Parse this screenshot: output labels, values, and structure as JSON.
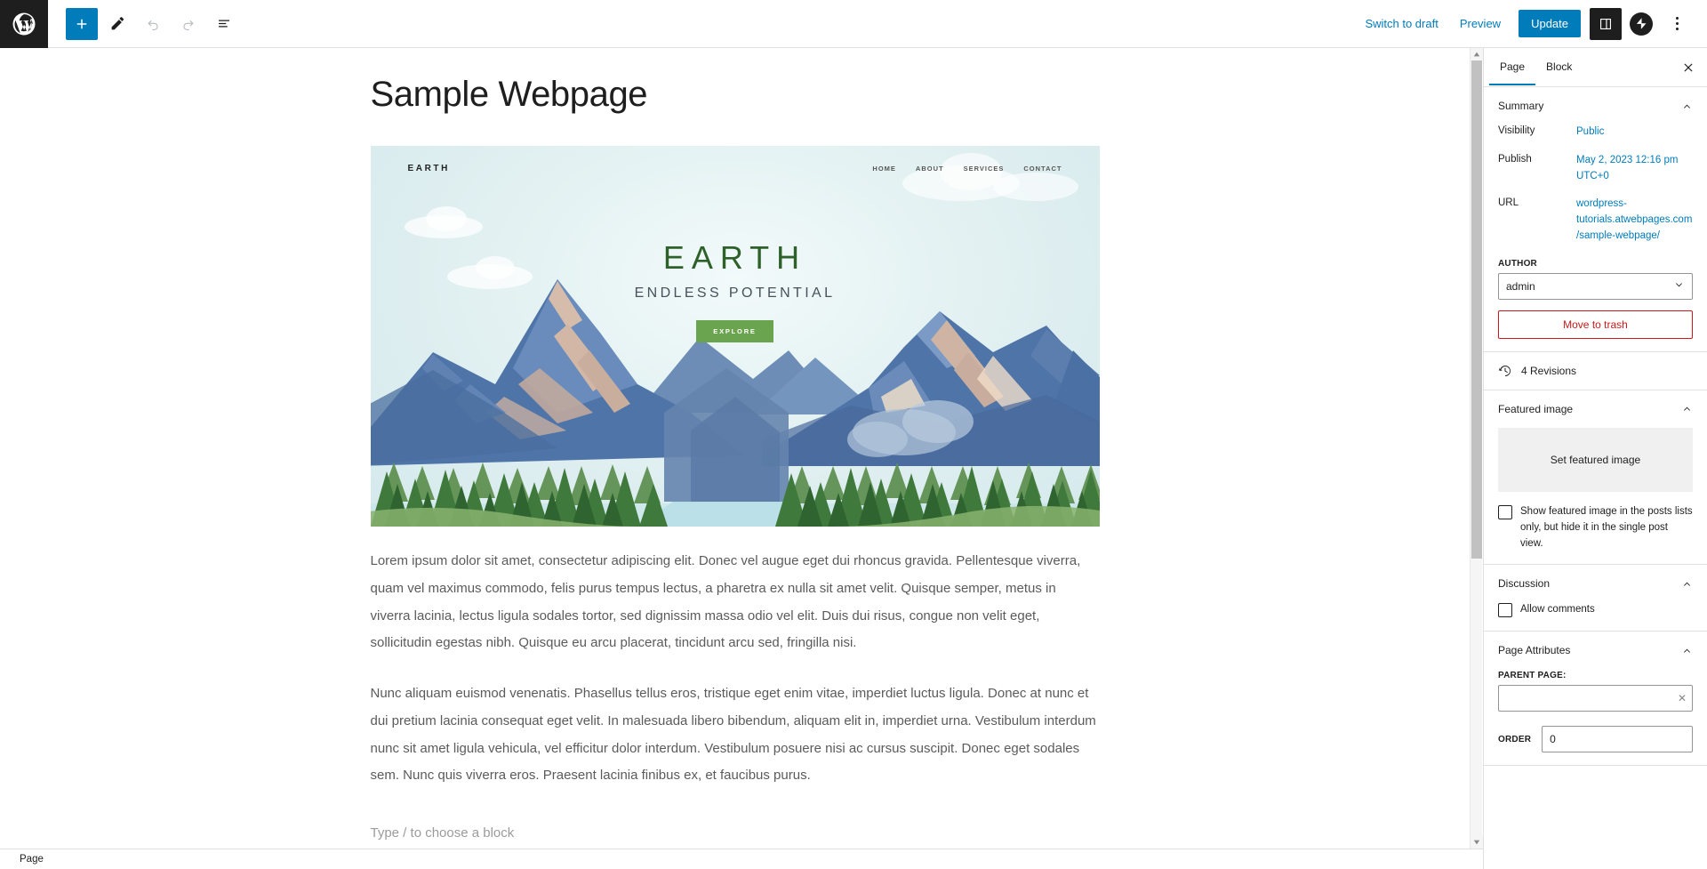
{
  "topbar": {
    "logo_icon": "wordpress-logo-icon",
    "left_tools": [
      {
        "name": "add-block-button",
        "icon": "plus-icon",
        "label": "Toggle block inserter",
        "state": "primary"
      },
      {
        "name": "edit-tools-button",
        "icon": "pencil-icon",
        "label": "Tools",
        "state": "normal"
      },
      {
        "name": "undo-button",
        "icon": "undo-arrow-icon",
        "label": "Undo",
        "state": "disabled"
      },
      {
        "name": "redo-button",
        "icon": "redo-arrow-icon",
        "label": "Redo",
        "state": "disabled"
      },
      {
        "name": "details-button",
        "icon": "list-view-icon",
        "label": "Details",
        "state": "normal"
      }
    ],
    "switch_to_draft": "Switch to draft",
    "preview": "Preview",
    "update": "Update",
    "settings_icon": "sidebar-panel-icon",
    "jetpack_icon": "jetpack-avatar-icon",
    "more_icon": "kebab-menu-icon"
  },
  "editor": {
    "title": "Sample Webpage",
    "hero": {
      "brand": "EARTH",
      "menu": [
        "HOME",
        "ABOUT",
        "SERVICES",
        "CONTACT"
      ],
      "headline": "EARTH",
      "subheadline": "ENDLESS POTENTIAL",
      "cta": "EXPLORE",
      "colors": {
        "headline": "#2d6129",
        "cta_bg": "#6ba44f",
        "sky": "#e3f1f2",
        "mountain_blue": "#5c7fb0",
        "mountain_dark": "#3f5f8f",
        "rock_tan": "#d3b9a8",
        "forest_green": "#3f7a3c",
        "lake": "#b9dfe6"
      }
    },
    "paragraphs": [
      "Lorem ipsum dolor sit amet, consectetur adipiscing elit. Donec vel augue eget dui rhoncus gravida. Pellentesque viverra, quam vel maximus commodo, felis purus tempus lectus, a pharetra ex nulla sit amet velit. Quisque semper, metus in viverra lacinia, lectus ligula sodales tortor, sed dignissim massa odio vel elit. Duis dui risus, congue non velit eget, sollicitudin egestas nibh. Quisque eu arcu placerat, tincidunt arcu sed, fringilla nisi.",
      "Nunc aliquam euismod venenatis. Phasellus tellus eros, tristique eget enim vitae, imperdiet luctus ligula. Donec at nunc et dui pretium lacinia consequat eget velit. In malesuada libero bibendum, aliquam elit in, imperdiet urna. Vestibulum interdum nunc sit amet ligula vehicula, vel efficitur dolor interdum. Vestibulum posuere nisi ac cursus suscipit. Donec eget sodales sem. Nunc quis viverra eros. Praesent lacinia finibus ex, et faucibus purus."
    ],
    "block_placeholder": "Type / to choose a block"
  },
  "sidebar": {
    "tabs": [
      {
        "label": "Page",
        "active": true
      },
      {
        "label": "Block",
        "active": false
      }
    ],
    "close_icon": "close-icon",
    "summary": {
      "title": "Summary",
      "visibility_label": "Visibility",
      "visibility_value": "Public",
      "publish_label": "Publish",
      "publish_value": "May 2, 2023 12:16 pm UTC+0",
      "url_label": "URL",
      "url_value": "wordpress-tutorials.atwebpages.com/sample-webpage/",
      "author_label": "AUTHOR",
      "author_value": "admin",
      "trash_button": "Move to trash"
    },
    "revisions": {
      "icon": "clock-revision-icon",
      "label": "4 Revisions"
    },
    "featured_image": {
      "title": "Featured image",
      "set_label": "Set featured image",
      "checkbox_label": "Show featured image in the posts lists only, but hide it in the single post view.",
      "checked": false
    },
    "discussion": {
      "title": "Discussion",
      "allow_comments_label": "Allow comments",
      "checked": false
    },
    "page_attributes": {
      "title": "Page Attributes",
      "parent_label": "PARENT PAGE:",
      "parent_value": "",
      "parent_placeholder": "",
      "clear_icon": "clear-x-icon",
      "order_label": "ORDER",
      "order_value": "0"
    }
  },
  "statusbar": {
    "breadcrumb": "Page"
  }
}
